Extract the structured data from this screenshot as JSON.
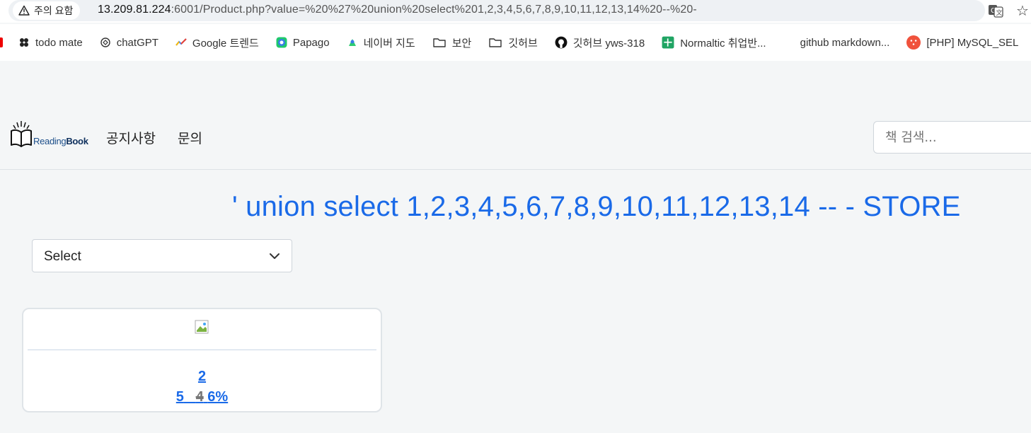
{
  "browser": {
    "security_chip": "주의 요함",
    "url_host": "13.209.81.224",
    "url_rest": ":6001/Product.php?value=%20%27%20union%20select%201,2,3,4,5,6,7,8,9,10,11,12,13,14%20--%20-"
  },
  "bookmarks": [
    {
      "label": "todo mate",
      "icon": "todo-mate-icon"
    },
    {
      "label": "chatGPT",
      "icon": "chatgpt-icon"
    },
    {
      "label": "Google 트렌드",
      "icon": "google-trends-icon"
    },
    {
      "label": "Papago",
      "icon": "papago-icon"
    },
    {
      "label": "네이버 지도",
      "icon": "naver-map-icon"
    },
    {
      "label": "보안",
      "icon": "folder-icon"
    },
    {
      "label": "깃허브",
      "icon": "folder-icon"
    },
    {
      "label": "깃허브 yws-318",
      "icon": "github-icon"
    },
    {
      "label": "Normaltic 취업반...",
      "icon": "sheets-icon"
    },
    {
      "label": "github markdown...",
      "icon": "blank-icon"
    },
    {
      "label": "[PHP] MySQL_SEL",
      "icon": "php-icon"
    }
  ],
  "nav": {
    "logo_text_1": "Reading",
    "logo_text_2": "Book",
    "links": [
      "공지사항",
      "문의"
    ],
    "search_placeholder": "책 검색..."
  },
  "main": {
    "title": "' union select 1,2,3,4,5,6,7,8,9,10,11,12,13,14 -- - STORE",
    "select_value": "Select"
  },
  "product": {
    "name": "2",
    "price": "5",
    "old_price": "4",
    "discount": "6%"
  },
  "colors": {
    "accent": "#1a6ae8",
    "page_bg": "#f4f6f7"
  }
}
